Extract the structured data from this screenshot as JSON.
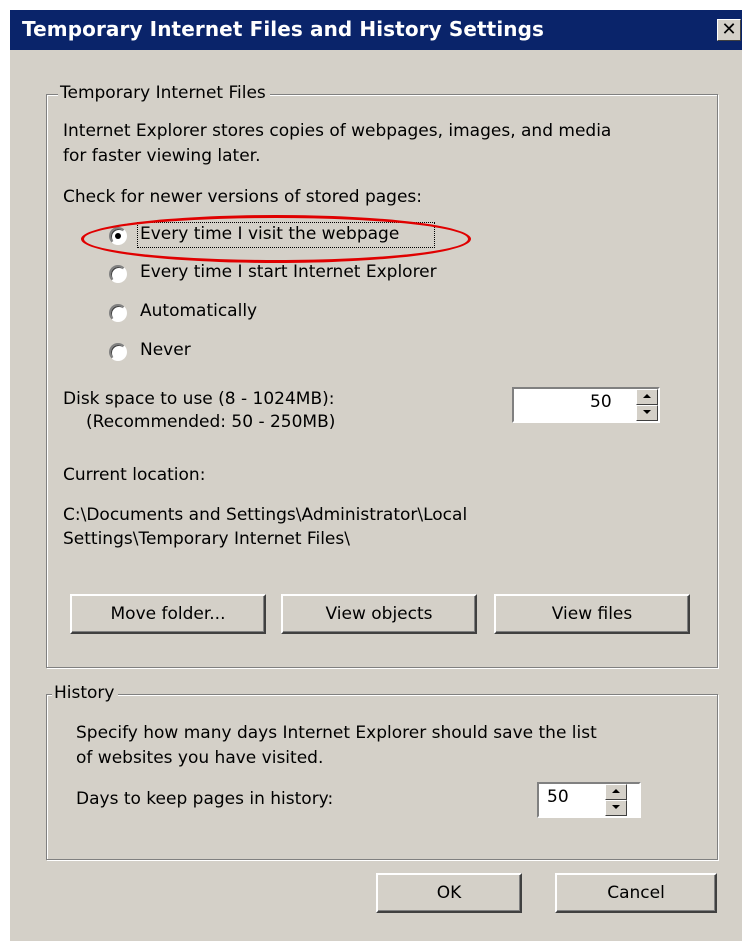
{
  "title": "Temporary Internet Files and History Settings",
  "close_glyph": "✕",
  "tif": {
    "legend": "Temporary Internet Files",
    "desc1": "Internet Explorer stores copies of webpages, images, and media",
    "desc2": "for faster viewing later.",
    "check_label": "Check for newer versions of stored pages:",
    "options": [
      {
        "label": "Every time I visit the webpage",
        "checked": true
      },
      {
        "label": "Every time I start Internet Explorer",
        "checked": false
      },
      {
        "label": "Automatically",
        "checked": false
      },
      {
        "label": "Never",
        "checked": false
      }
    ],
    "disk_label": "Disk space to use (8 - 1024MB):",
    "disk_recommended": "(Recommended: 50 - 250MB)",
    "disk_value": "50",
    "current_location_label": "Current location:",
    "location_line1": "C:\\Documents and Settings\\Administrator\\Local",
    "location_line2": "Settings\\Temporary Internet Files\\",
    "buttons": {
      "move": "Move folder...",
      "view_objects": "View objects",
      "view_files": "View files"
    }
  },
  "history": {
    "legend": "History",
    "desc1": "Specify how many days Internet Explorer should save the list",
    "desc2": "of websites you have visited.",
    "days_label": "Days to keep pages in history:",
    "days_value": "50"
  },
  "footer": {
    "ok": "OK",
    "cancel": "Cancel"
  },
  "colors": {
    "title_bar": "#0a246a",
    "dialog_bg": "#d4d0c8",
    "highlight": "#e00000"
  }
}
